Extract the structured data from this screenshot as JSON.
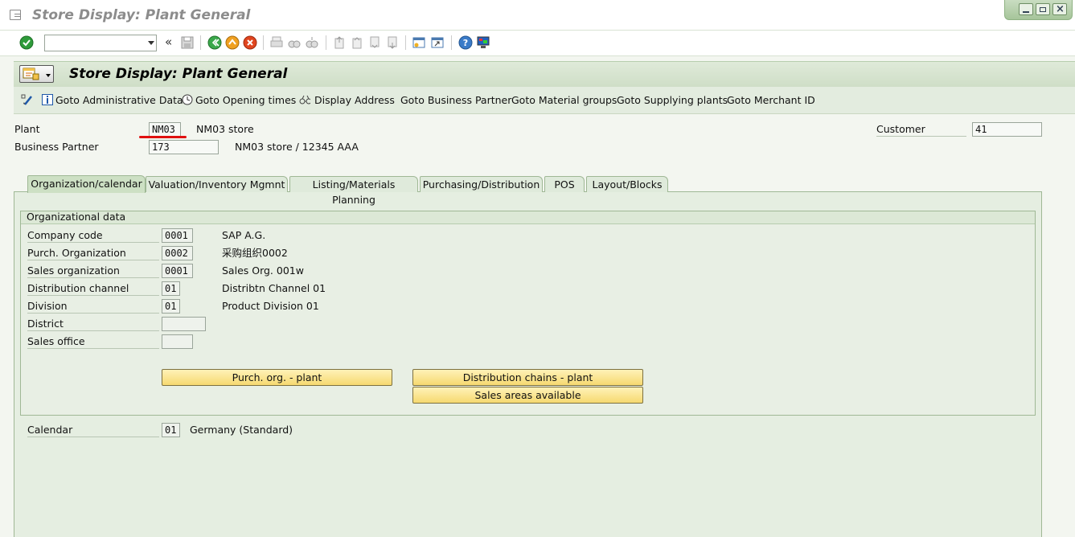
{
  "window": {
    "title": "Store Display: Plant General"
  },
  "screen": {
    "title": "Store Display: Plant General"
  },
  "app_toolbar": {
    "items": [
      {
        "label": "Goto Administrative Data",
        "icon": "info-icon"
      },
      {
        "label": "Goto Opening times",
        "icon": "clock-icon"
      },
      {
        "label": "Display Address",
        "icon": "address-icon"
      },
      {
        "label": "Goto Business Partner"
      },
      {
        "label": "Goto Material groups"
      },
      {
        "label": "Goto Supplying plants"
      },
      {
        "label": "Goto Merchant ID"
      }
    ]
  },
  "header": {
    "plant_label": "Plant",
    "plant_value": "NM03",
    "plant_desc": "NM03 store",
    "bp_label": "Business Partner",
    "bp_value": "173",
    "bp_desc": "NM03 store / 12345 AAA",
    "customer_label": "Customer",
    "customer_value": "41"
  },
  "tabs": [
    {
      "label": "Organization/calendar",
      "active": true
    },
    {
      "label": "Valuation/Inventory Mgmnt"
    },
    {
      "label": "Listing/Materials Planning"
    },
    {
      "label": "Purchasing/Distribution"
    },
    {
      "label": "POS"
    },
    {
      "label": "Layout/Blocks"
    }
  ],
  "org": {
    "title": "Organizational data",
    "rows": [
      {
        "label": "Company code",
        "value": "0001",
        "desc": "SAP A.G."
      },
      {
        "label": "Purch. Organization",
        "value": "0002",
        "desc": "采购组织0002"
      },
      {
        "label": "Sales organization",
        "value": "0001",
        "desc": "Sales Org. 001w"
      },
      {
        "label": "Distribution channel",
        "value": "01",
        "desc": "Distribtn Channel 01"
      },
      {
        "label": "Division",
        "value": "01",
        "desc": "Product Division 01"
      },
      {
        "label": "District",
        "value": "",
        "desc": ""
      },
      {
        "label": "Sales office",
        "value": "",
        "desc": ""
      }
    ],
    "buttons": {
      "purch_plant": "Purch. org. - plant",
      "dist_chains": "Distribution chains - plant",
      "sales_areas": "Sales areas available"
    }
  },
  "calendar": {
    "label": "Calendar",
    "value": "01",
    "desc": "Germany (Standard)"
  },
  "command_field": {
    "value": ""
  },
  "colors": {
    "accent_green": "#2e9b3a",
    "button_yellow": "#f6d970",
    "highlight_red": "#e01010"
  }
}
